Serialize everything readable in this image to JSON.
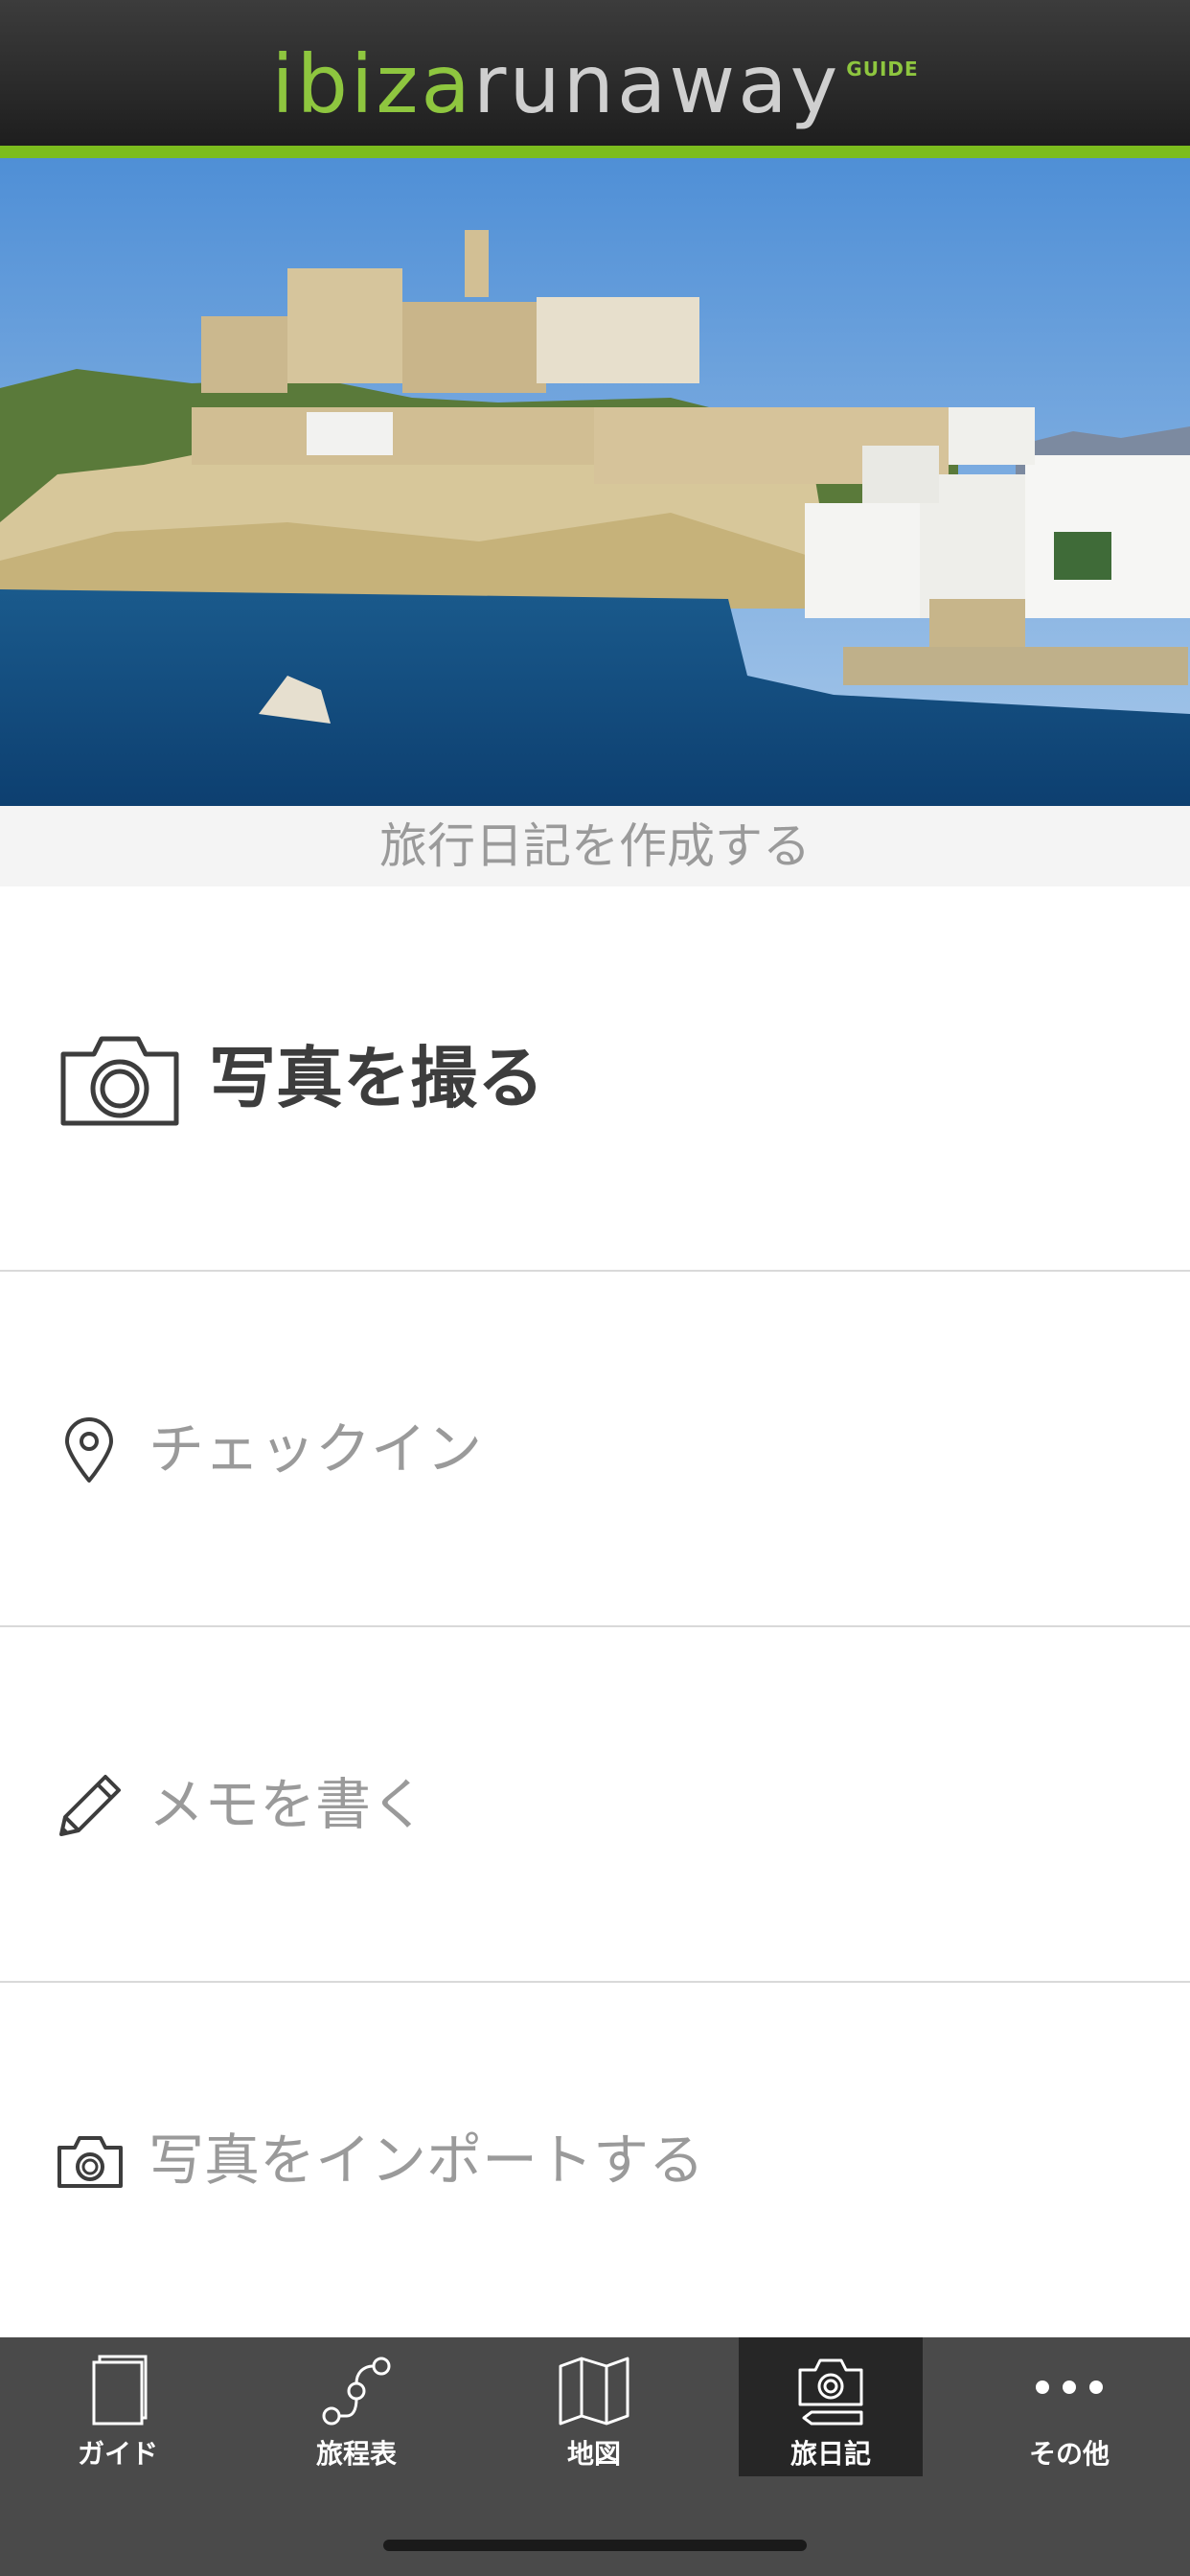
{
  "header": {
    "logo_part1": "ibiza",
    "logo_part2": "runaway",
    "logo_suffix": "GUIDE",
    "accent_color": "#7cbd1e"
  },
  "subtitle": "旅行日記を作成する",
  "actions": [
    {
      "label": "写真を撮る",
      "icon": "camera-icon"
    },
    {
      "label": "チェックイン",
      "icon": "map-pin-icon"
    },
    {
      "label": "メモを書く",
      "icon": "pencil-icon"
    },
    {
      "label": "写真をインポートする",
      "icon": "camera-small-icon"
    }
  ],
  "tabs": [
    {
      "label": "ガイド",
      "icon": "book-icon",
      "active": false
    },
    {
      "label": "旅程表",
      "icon": "route-icon",
      "active": false
    },
    {
      "label": "地図",
      "icon": "map-icon",
      "active": false
    },
    {
      "label": "旅日記",
      "icon": "camera-pencil-icon",
      "active": true
    },
    {
      "label": "その他",
      "icon": "more-dots-icon",
      "active": false
    }
  ]
}
